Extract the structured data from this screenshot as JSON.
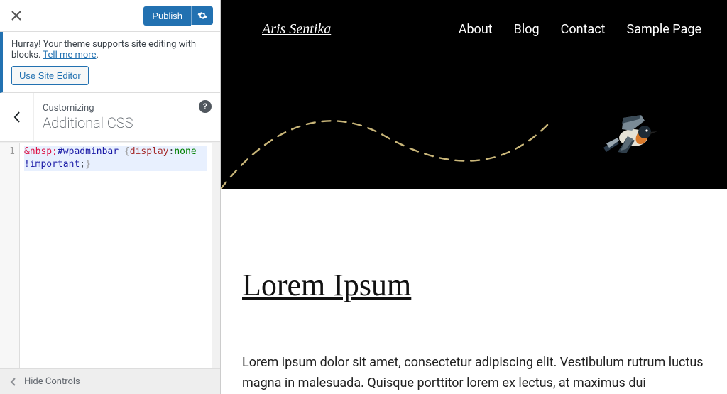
{
  "topbar": {
    "publish_label": "Publish"
  },
  "notice": {
    "text_before": "Hurray! Your theme supports site editing with blocks. ",
    "link_text": "Tell me more",
    "dot": ".",
    "button_label": "Use Site Editor"
  },
  "section": {
    "pre": "Customizing",
    "title": "Additional CSS"
  },
  "code": {
    "line_no": "1",
    "raw": "&nbsp;#wpadminbar {display:none !important;}",
    "tok": {
      "amp": "&nbsp;",
      "sel": "#wpadminbar",
      "ob": " {",
      "prop": "display",
      "colon": ":",
      "val": "none",
      "imp": " !important",
      "semi": ";",
      "cb": "}"
    }
  },
  "footer": {
    "label": "Hide Controls"
  },
  "preview": {
    "brand": "Aris Sentika",
    "nav": [
      "About",
      "Blog",
      "Contact",
      "Sample Page"
    ],
    "heading": "Lorem Ipsum",
    "body": "Lorem ipsum dolor sit amet, consectetur adipiscing elit. Vestibulum rutrum luctus magna in malesuada. Quisque porttitor lorem ex lectus, at maximus dui"
  }
}
